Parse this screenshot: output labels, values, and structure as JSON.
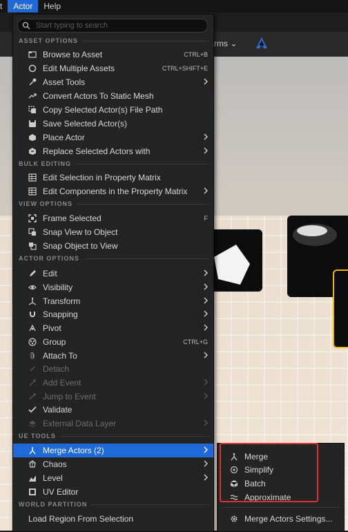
{
  "menubar": {
    "items": [
      {
        "label": "ct"
      },
      {
        "label": "Actor"
      },
      {
        "label": "Help"
      }
    ]
  },
  "toolbar": {
    "partial_label": "rms ⌄"
  },
  "search": {
    "placeholder": "Start typing to search",
    "value": ""
  },
  "menu": {
    "sections": {
      "asset_options": "ASSET OPTIONS",
      "bulk_editing": "BULK EDITING",
      "view_options": "VIEW OPTIONS",
      "actor_options": "ACTOR OPTIONS",
      "ue_tools": "UE TOOLS",
      "world_partition": "WORLD PARTITION"
    },
    "items": [
      {
        "label": "Browse to Asset",
        "shortcut": "CTRL+B",
        "icon": "browse-icon"
      },
      {
        "label": "Edit Multiple Assets",
        "shortcut": "CTRL+SHIFT+E",
        "icon": "edit-circle-icon"
      },
      {
        "label": "Asset Tools",
        "icon": "asset-tools-icon",
        "submenu": true
      },
      {
        "label": "Convert Actors To Static Mesh",
        "icon": "convert-icon"
      },
      {
        "label": "Copy Selected Actor(s) File Path",
        "icon": "copy-icon"
      },
      {
        "label": "Save Selected Actor(s)",
        "icon": "save-icon"
      },
      {
        "label": "Place Actor",
        "icon": "place-actor-icon",
        "submenu": true
      },
      {
        "label": "Replace Selected Actors with",
        "icon": "replace-icon",
        "submenu": true
      },
      {
        "label": "Edit Selection in Property Matrix",
        "icon": "grid-icon"
      },
      {
        "label": "Edit Components in the Property Matrix",
        "icon": "grid-icon",
        "submenu": true
      },
      {
        "label": "Frame Selected",
        "shortcut": "F",
        "icon": "frame-icon"
      },
      {
        "label": "Snap View to Object",
        "icon": "snap-view-icon"
      },
      {
        "label": "Snap Object to View",
        "icon": "snap-object-icon"
      },
      {
        "label": "Edit",
        "icon": "pencil-icon",
        "submenu": true
      },
      {
        "label": "Visibility",
        "icon": "eye-icon",
        "submenu": true
      },
      {
        "label": "Transform",
        "icon": "transform-icon",
        "submenu": true
      },
      {
        "label": "Snapping",
        "icon": "magnet-icon",
        "submenu": true
      },
      {
        "label": "Pivot",
        "icon": "pivot-icon",
        "submenu": true
      },
      {
        "label": "Group",
        "shortcut": "CTRL+G",
        "icon": "group-icon"
      },
      {
        "label": "Attach To",
        "icon": "paperclip-icon",
        "submenu": true
      },
      {
        "label": "Detach",
        "icon": "detach-icon",
        "disabled": true
      },
      {
        "label": "Add Event",
        "icon": "add-event-icon",
        "disabled": true,
        "submenu": true
      },
      {
        "label": "Jump to Event",
        "icon": "jump-event-icon",
        "disabled": true,
        "submenu": true
      },
      {
        "label": "Validate",
        "icon": "check-icon"
      },
      {
        "label": "External Data Layer",
        "icon": "layer-icon",
        "disabled": true,
        "submenu": true
      },
      {
        "label": "Merge Actors (2)",
        "icon": "merge-icon",
        "submenu": true,
        "selected": true
      },
      {
        "label": "Chaos",
        "icon": "chaos-icon",
        "submenu": true
      },
      {
        "label": "Level",
        "icon": "level-icon",
        "submenu": true
      },
      {
        "label": "UV Editor",
        "icon": "uv-icon"
      },
      {
        "label": "Load Region From Selection"
      }
    ]
  },
  "submenu": {
    "items": [
      {
        "label": "Merge",
        "icon": "merge-icon"
      },
      {
        "label": "Simplify",
        "icon": "simplify-icon"
      },
      {
        "label": "Batch",
        "icon": "batch-icon"
      },
      {
        "label": "Approximate",
        "icon": "approximate-icon"
      },
      {
        "label": "Merge Actors Settings...",
        "icon": "gear-icon"
      }
    ]
  },
  "colors": {
    "accent": "#1f6ad8",
    "highlight_box": "#e03131",
    "menu_bg": "#242424"
  }
}
